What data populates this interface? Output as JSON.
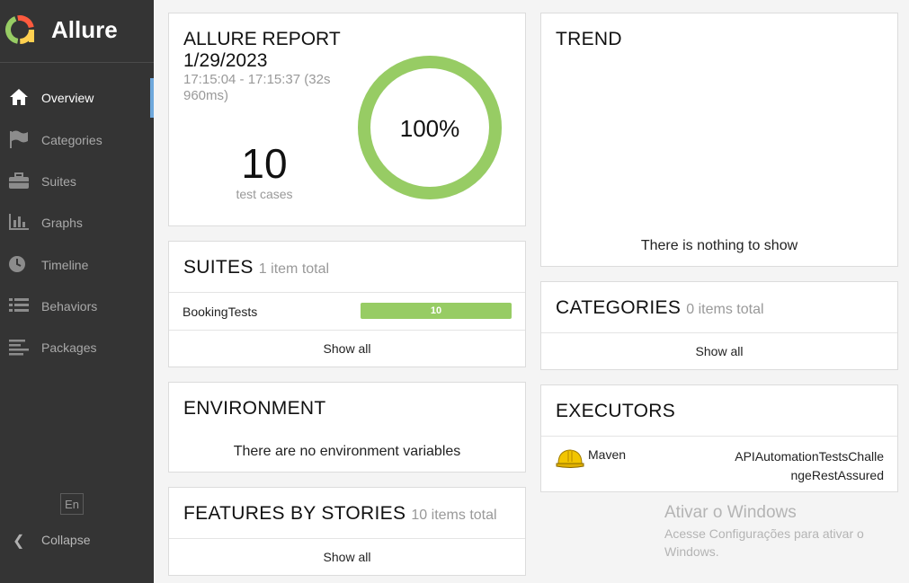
{
  "brand": {
    "name": "Allure"
  },
  "nav": {
    "items": [
      {
        "label": "Overview",
        "icon": "home-icon",
        "active": true
      },
      {
        "label": "Categories",
        "icon": "flag-icon"
      },
      {
        "label": "Suites",
        "icon": "briefcase-icon"
      },
      {
        "label": "Graphs",
        "icon": "bar-chart-icon"
      },
      {
        "label": "Timeline",
        "icon": "clock-icon"
      },
      {
        "label": "Behaviors",
        "icon": "list-icon"
      },
      {
        "label": "Packages",
        "icon": "align-left-icon"
      }
    ],
    "language": "En",
    "collapse_label": "Collapse"
  },
  "summary": {
    "title": "ALLURE REPORT",
    "date": "1/29/2023",
    "time_range": "17:15:04 - 17:15:37 (32s",
    "duration_tail": "960ms)",
    "count": "10",
    "count_label": "test cases",
    "percent_label": "100%",
    "passed_fraction": 1.0,
    "ring_color": "#97cc64"
  },
  "suites": {
    "title": "SUITES",
    "subtitle": "1 item total",
    "rows": [
      {
        "name": "BookingTests",
        "passed": 10,
        "bar_color": "#97cc64"
      }
    ],
    "show_all": "Show all"
  },
  "environment": {
    "title": "ENVIRONMENT",
    "message": "There are no environment variables"
  },
  "features": {
    "title": "FEATURES BY STORIES",
    "subtitle": "10 items total",
    "show_all": "Show all"
  },
  "trend": {
    "title": "TREND",
    "message": "There is nothing to show"
  },
  "categories": {
    "title": "CATEGORIES",
    "subtitle": "0 items total",
    "show_all": "Show all"
  },
  "executors": {
    "title": "EXECUTORS",
    "name": "Maven",
    "build_line1": "APIAutomationTestsChalle",
    "build_line2": "ngeRestAssured",
    "icon": "hard-hat-icon"
  },
  "watermark": {
    "title": "Ativar o Windows",
    "subtitle": "Acesse Configurações para ativar o Windows."
  }
}
